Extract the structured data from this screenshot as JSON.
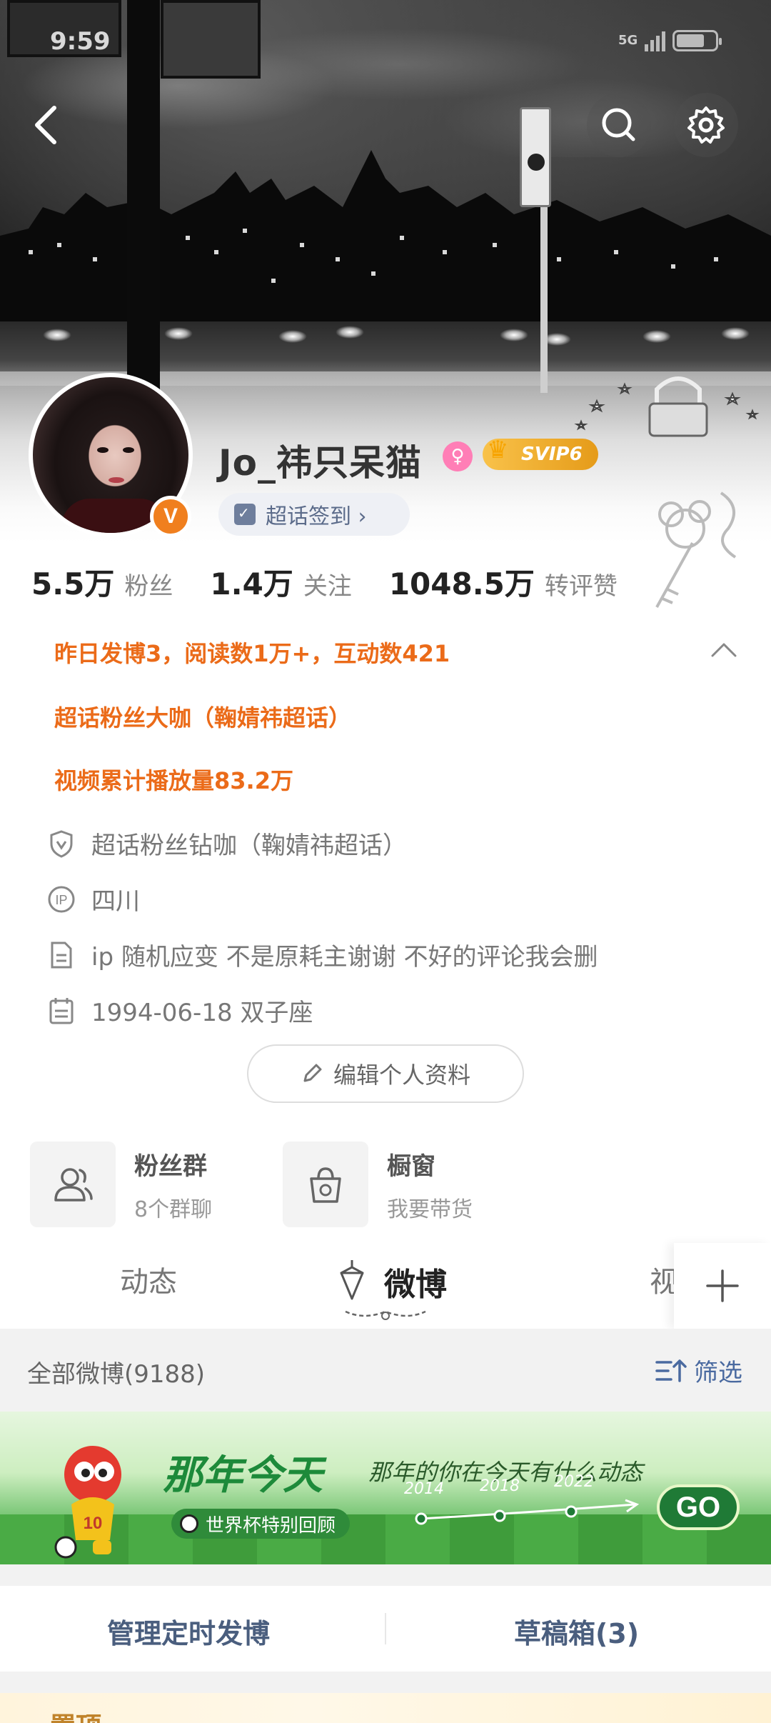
{
  "status_bar": {
    "time": "9:59",
    "network": "5G"
  },
  "profile": {
    "username": "Jo_祎只呆猫",
    "gender_symbol": "♀",
    "vip_badge": "SVIP6",
    "verified_mark": "V",
    "chaohua_checkin": "超话签到 ›"
  },
  "stats": [
    {
      "value": "5.5万",
      "label": "粉丝"
    },
    {
      "value": "1.4万",
      "label": "关注"
    },
    {
      "value": "1048.5万",
      "label": "转评赞"
    }
  ],
  "highlights": [
    "昨日发博3，阅读数1万+，互动数421",
    "超话粉丝大咖（鞠婧祎超话）",
    "视频累计播放量83.2万"
  ],
  "info": {
    "badge": "超话粉丝钻咖（鞠婧祎超话）",
    "ip": "四川",
    "bio": "ip 随机应变 不是原耗主谢谢 不好的评论我会删",
    "birthday": "1994-06-18 双子座"
  },
  "edit_profile_label": "编辑个人资料",
  "services": [
    {
      "title": "粉丝群",
      "subtitle": "8个群聊",
      "icon": "people-icon"
    },
    {
      "title": "橱窗",
      "subtitle": "我要带货",
      "icon": "shopping-bag-icon"
    }
  ],
  "tabs": {
    "dongtai": "动态",
    "weibo": "微博",
    "video": "视",
    "plus": "+"
  },
  "filter": {
    "all_label": "全部微博(9188)",
    "filter_label": "筛选"
  },
  "banner": {
    "title": "那年今天",
    "subtitle": "那年的你在今天有什么动态",
    "pill": "世界杯特别回顾",
    "years": [
      "2014",
      "2018",
      "2022"
    ],
    "go": "GO",
    "jersey": "10"
  },
  "actions": {
    "scheduled": "管理定时发博",
    "drafts": "草稿箱(3)"
  },
  "bottom_peek": "置顶",
  "colors": {
    "highlight": "#eb6b19",
    "link": "#4a6aa0",
    "accent": "#f07f1e"
  }
}
